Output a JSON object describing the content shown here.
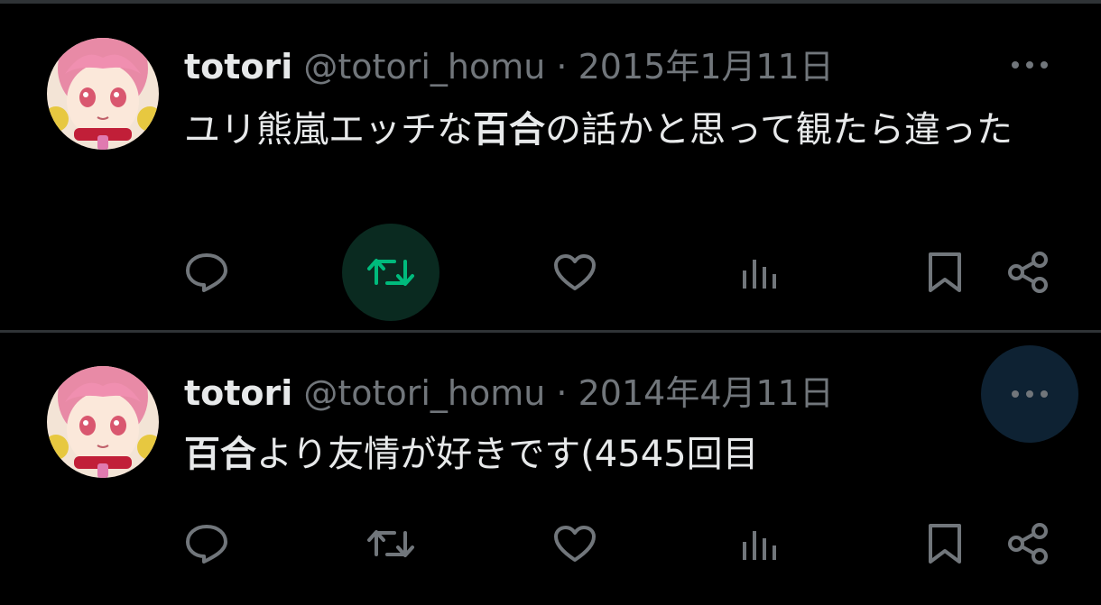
{
  "colors": {
    "background": "#000000",
    "text_primary": "#e7e9ea",
    "text_secondary": "#71767b",
    "retweet_active": "#00ba7c",
    "divider": "#2f3336"
  },
  "tweets": [
    {
      "name": "totori",
      "handle": "@totori_homu",
      "separator": "·",
      "date": "2015年1月11日",
      "text_before": "ユリ熊嵐エッチな",
      "text_bold": "百合",
      "text_after": "の話かと思って観たら違った",
      "retweeted": true,
      "icons": [
        "reply-icon",
        "retweet-icon",
        "like-icon",
        "views-icon",
        "bookmark-icon",
        "share-icon"
      ]
    },
    {
      "name": "totori",
      "handle": "@totori_homu",
      "separator": "·",
      "date": "2014年4月11日",
      "text_before": "",
      "text_bold": "百合",
      "text_after": "より友情が好きです(4545回目",
      "retweeted": false,
      "icons": [
        "reply-icon",
        "retweet-icon",
        "like-icon",
        "views-icon",
        "bookmark-icon",
        "share-icon"
      ]
    }
  ]
}
